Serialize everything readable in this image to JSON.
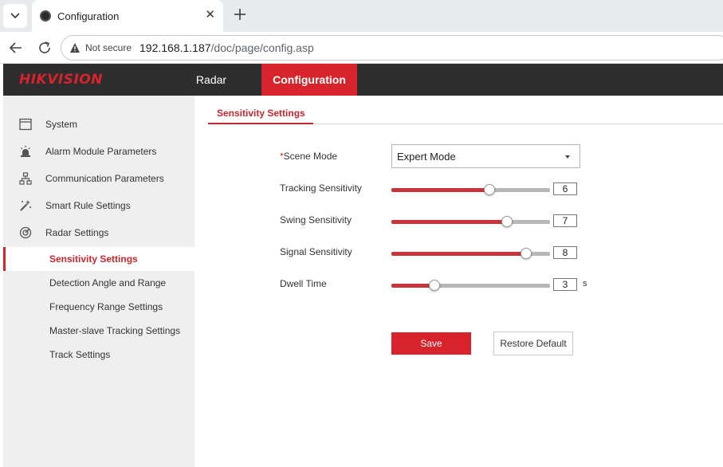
{
  "browser": {
    "tab_title": "Configuration",
    "not_secure_label": "Not secure",
    "url_host": "192.168.1.187",
    "url_path": "/doc/page/config.asp"
  },
  "header": {
    "logo_text": "HIKVISION",
    "nav": [
      {
        "label": "Radar"
      },
      {
        "label": "Configuration",
        "active": true
      }
    ]
  },
  "sidebar": {
    "items": [
      {
        "label": "System",
        "icon": "monitor-icon"
      },
      {
        "label": "Alarm Module Parameters",
        "icon": "alarm-light-icon"
      },
      {
        "label": "Communication Parameters",
        "icon": "network-icon"
      },
      {
        "label": "Smart Rule Settings",
        "icon": "magic-wand-icon"
      },
      {
        "label": "Radar Settings",
        "icon": "radar-icon"
      }
    ],
    "sub_items": [
      {
        "label": "Sensitivity Settings",
        "active": true
      },
      {
        "label": "Detection Angle and Range"
      },
      {
        "label": "Frequency Range Settings"
      },
      {
        "label": "Master-slave Tracking Settings"
      },
      {
        "label": "Track Settings"
      }
    ]
  },
  "main": {
    "tab_label": "Sensitivity Settings",
    "scene_mode": {
      "required_mark": "*",
      "label": "Scene Mode",
      "value": "Expert Mode"
    },
    "sliders": [
      {
        "label": "Tracking Sensitivity",
        "value": "6",
        "fraction": 0.62
      },
      {
        "label": "Swing Sensitivity",
        "value": "7",
        "fraction": 0.73
      },
      {
        "label": "Signal Sensitivity",
        "value": "8",
        "fraction": 0.85
      },
      {
        "label": "Dwell Time",
        "value": "3",
        "fraction": 0.27,
        "unit": "s"
      }
    ],
    "save_label": "Save",
    "restore_label": "Restore Default"
  },
  "colors": {
    "brand_red": "#d7232b",
    "header_bg": "#2d2d2d",
    "sidebar_bg": "#efefef"
  }
}
